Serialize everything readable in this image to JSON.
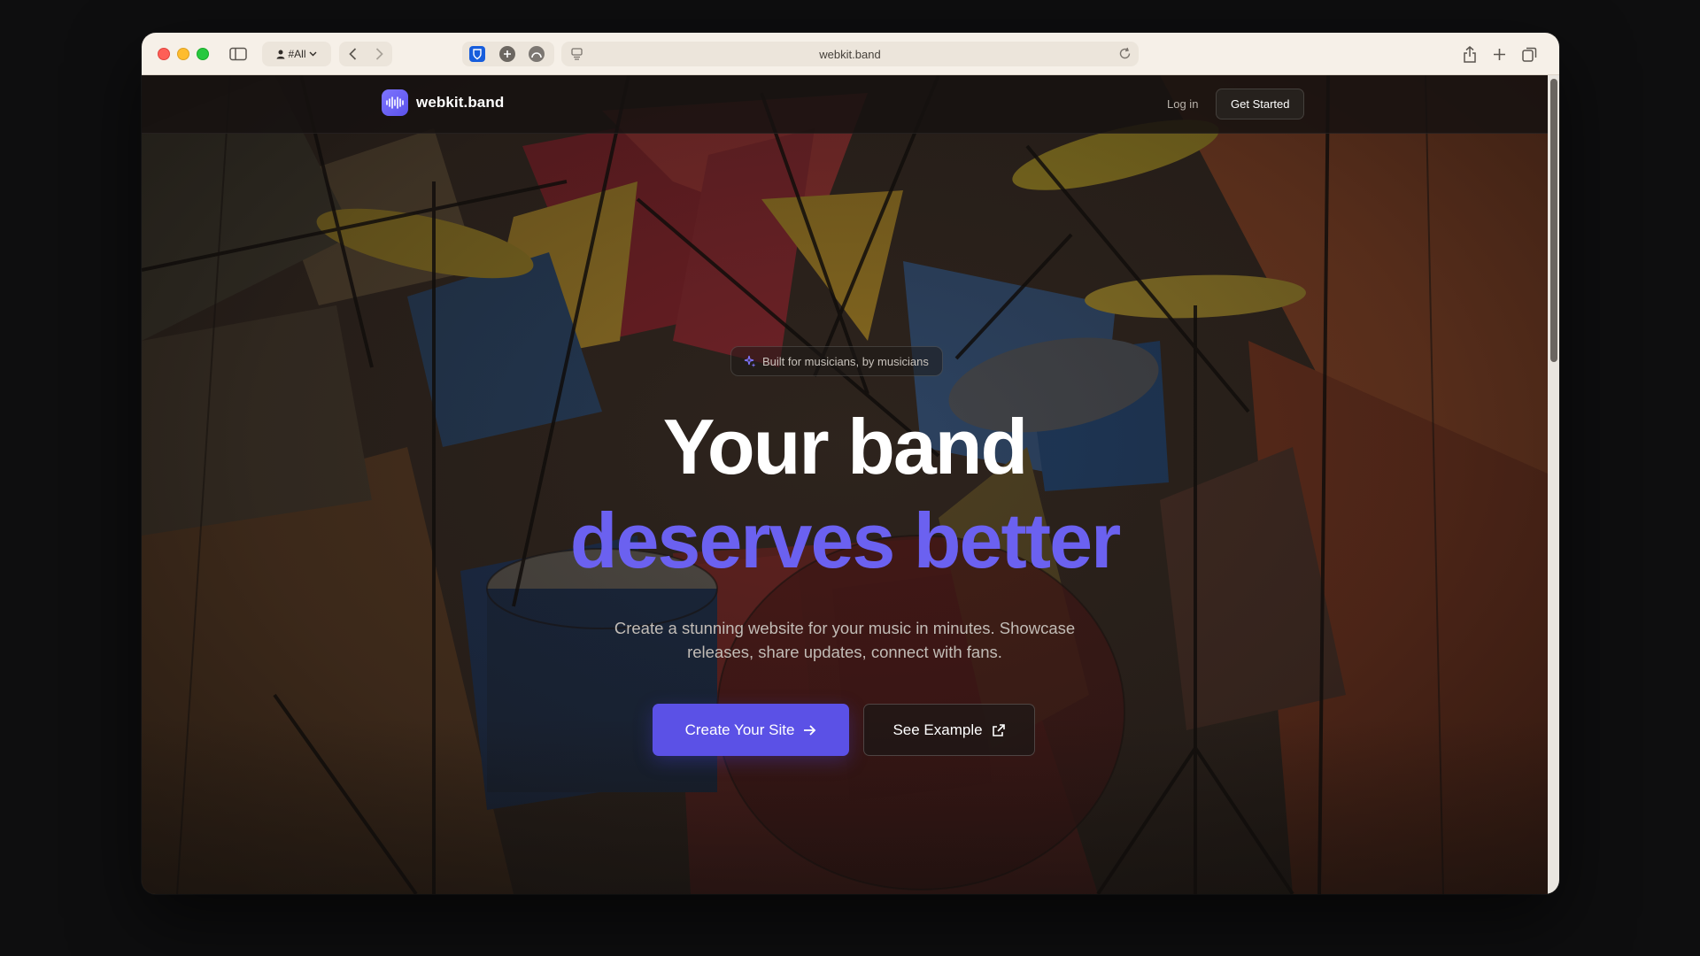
{
  "browser": {
    "profile_label": "#All",
    "url": "webkit.band"
  },
  "site": {
    "brand_name": "webkit.band",
    "nav": {
      "login_label": "Log in",
      "get_started_label": "Get Started"
    }
  },
  "hero": {
    "badge_text": "Built for musicians, by musicians",
    "headline_line1": "Your band",
    "headline_line2": "deserves better",
    "subtext": "Create a stunning website for your music in minutes. Showcase releases, share updates, connect with fans.",
    "primary_cta": "Create Your Site",
    "secondary_cta": "See Example"
  },
  "colors": {
    "accent": "#6b61f0",
    "primary_button": "#5b51e6"
  }
}
